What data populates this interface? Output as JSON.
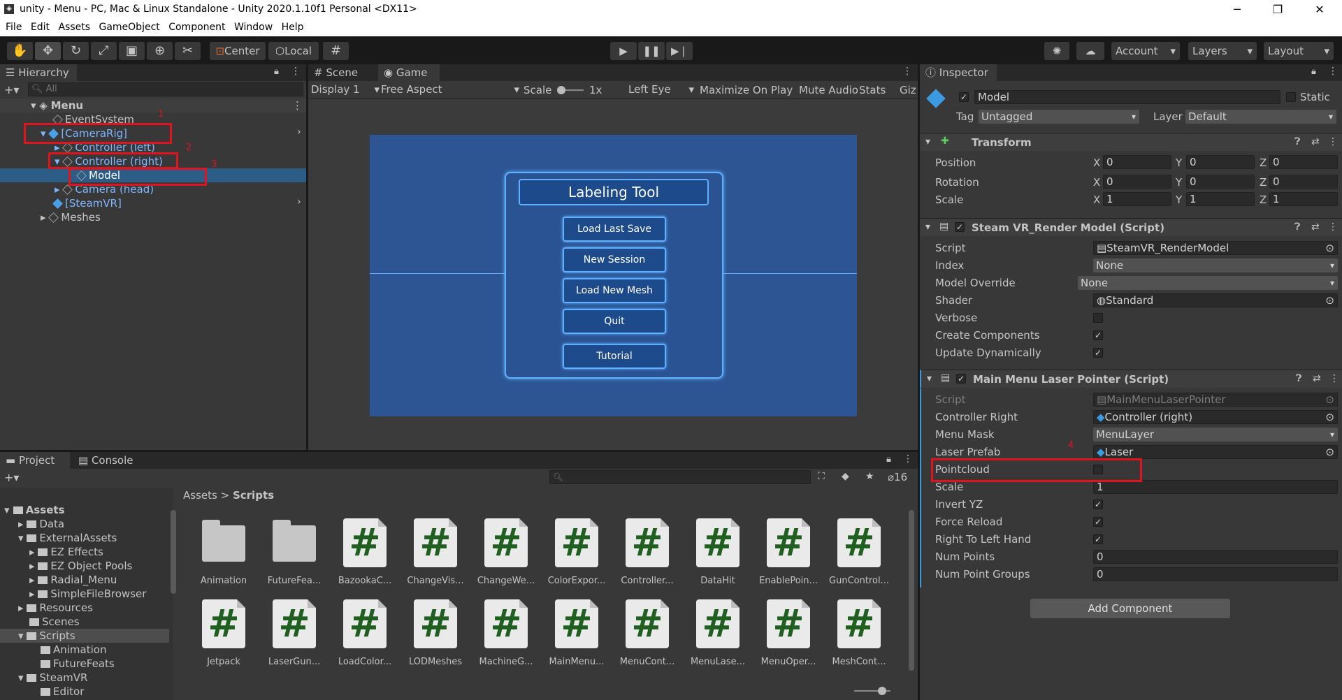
{
  "window": {
    "title": "unity - Menu - PC, Mac & Linux Standalone - Unity 2020.1.10f1 Personal <DX11>",
    "min": "─",
    "max": "❐",
    "close": "✕"
  },
  "menu": [
    "File",
    "Edit",
    "Assets",
    "GameObject",
    "Component",
    "Window",
    "Help"
  ],
  "toolbar": {
    "center": "Center",
    "local": "Local",
    "account": "Account",
    "layers": "Layers",
    "layout": "Layout"
  },
  "hierarchy": {
    "tab": "Hierarchy",
    "search": "All",
    "scene": "Menu",
    "items": [
      "EventSystem",
      "[CameraRig]",
      "Controller (left)",
      "Controller (right)",
      "Model",
      "Camera (head)",
      "[SteamVR]",
      "Meshes"
    ]
  },
  "game": {
    "tab_scene": "Scene",
    "tab_game": "Game",
    "display": "Display 1",
    "aspect": "Free Aspect",
    "scale": "Scale",
    "scale_val": "1x",
    "eye": "Left Eye",
    "maximize": "Maximize On Play",
    "mute": "Mute Audio",
    "stats": "Stats",
    "gizmos": "Giz",
    "menu_title": "Labeling Tool",
    "buttons": [
      "Load Last Save",
      "New Session",
      "Load New Mesh",
      "Quit",
      "Tutorial"
    ]
  },
  "inspector": {
    "tab": "Inspector",
    "name": "Model",
    "static": "Static",
    "tag_label": "Tag",
    "tag": "Untagged",
    "layer_label": "Layer",
    "layer": "Default",
    "transform": {
      "title": "Transform",
      "position": "Position",
      "rotation": "Rotation",
      "scale": "Scale",
      "x": "X",
      "y": "Y",
      "z": "Z",
      "pos": [
        "0",
        "0",
        "0"
      ],
      "rot": [
        "0",
        "0",
        "0"
      ],
      "scl": [
        "1",
        "1",
        "1"
      ]
    },
    "render": {
      "title": "Steam VR_Render Model (Script)",
      "labels": [
        "Script",
        "Index",
        "Model Override",
        "Shader",
        "Verbose",
        "Create Components",
        "Update Dynamically"
      ],
      "script": "SteamVR_RenderModel",
      "index": "None",
      "override": "None",
      "shader": "Standard"
    },
    "laser": {
      "title": "Main Menu Laser Pointer (Script)",
      "labels": [
        "Script",
        "Controller Right",
        "Menu Mask",
        "Laser Prefab",
        "Pointcloud",
        "Scale",
        "Invert YZ",
        "Force Reload",
        "Right To Left Hand",
        "Num Points",
        "Num Point Groups"
      ],
      "script": "MainMenuLaserPointer",
      "controller": "Controller (right)",
      "mask": "MenuLayer",
      "prefab": "Laser",
      "scale": "1",
      "num_points": "0",
      "num_groups": "0"
    },
    "add": "Add Component"
  },
  "project": {
    "tab_project": "Project",
    "tab_console": "Console",
    "count": "16",
    "crumb_root": "Assets",
    "crumb_sep": ">",
    "crumb_cur": "Scripts",
    "tree": [
      "Assets",
      "Data",
      "ExternalAssets",
      "EZ Effects",
      "EZ Object Pools",
      "Radial_Menu",
      "SimpleFileBrowser",
      "Resources",
      "Scenes",
      "Scripts",
      "Animation",
      "FutureFeats",
      "SteamVR",
      "Editor"
    ],
    "assets_row1": [
      "Animation",
      "FutureFea...",
      "BazookaC...",
      "ChangeVis...",
      "ChangeWe...",
      "ColorExpor...",
      "Controller...",
      "DataHit",
      "EnablePoin...",
      "GunControl..."
    ],
    "assets_row2": [
      "Jetpack",
      "LaserGun...",
      "LoadColor...",
      "LODMeshes",
      "MachineG...",
      "MainMenu...",
      "MenuCont...",
      "MenuLase...",
      "MenuOper...",
      "MeshCont..."
    ]
  },
  "annotations": [
    "1",
    "2",
    "3",
    "4"
  ]
}
